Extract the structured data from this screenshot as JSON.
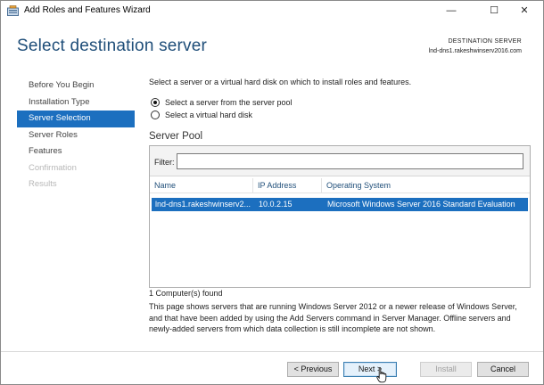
{
  "window": {
    "title": "Add Roles and Features Wizard",
    "minimize_glyph": "—",
    "maximize_glyph": "☐",
    "close_glyph": "✕"
  },
  "header": {
    "title": "Select destination server",
    "destination_label": "DESTINATION SERVER",
    "destination_value": "lnd-dns1.rakeshwinserv2016.com"
  },
  "nav": {
    "items": [
      {
        "label": "Before You Begin",
        "state": "normal"
      },
      {
        "label": "Installation Type",
        "state": "normal"
      },
      {
        "label": "Server Selection",
        "state": "active"
      },
      {
        "label": "Server Roles",
        "state": "normal"
      },
      {
        "label": "Features",
        "state": "normal"
      },
      {
        "label": "Confirmation",
        "state": "disabled"
      },
      {
        "label": "Results",
        "state": "disabled"
      }
    ]
  },
  "main": {
    "instruction": "Select a server or a virtual hard disk on which to install roles and features.",
    "options": [
      {
        "label": "Select a server from the server pool",
        "checked": true
      },
      {
        "label": "Select a virtual hard disk",
        "checked": false
      }
    ],
    "pool_title": "Server Pool",
    "filter_label": "Filter:",
    "filter_value": "",
    "columns": [
      "Name",
      "IP Address",
      "Operating System"
    ],
    "rows": [
      {
        "name": "lnd-dns1.rakeshwinserv2...",
        "ip": "10.0.2.15",
        "os": "Microsoft Windows Server 2016 Standard Evaluation",
        "selected": true
      }
    ],
    "count_text": "1 Computer(s) found",
    "description": "This page shows servers that are running Windows Server 2012 or a newer release of Windows Server, and that have been added by using the Add Servers command in Server Manager. Offline servers and newly-added servers from which data collection is still incomplete are not shown."
  },
  "footer": {
    "previous": "< Previous",
    "next": "Next >",
    "install": "Install",
    "cancel": "Cancel"
  },
  "colors": {
    "accent": "#1c6fbf",
    "title": "#1f4e79",
    "disabled": "#b8b8b8"
  }
}
